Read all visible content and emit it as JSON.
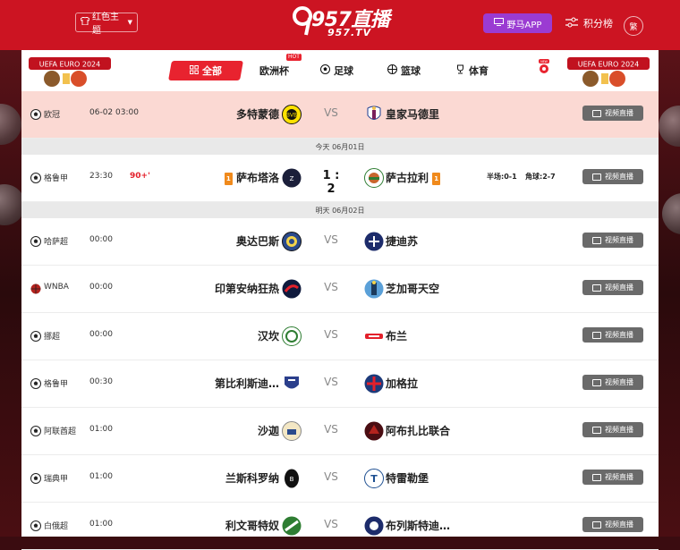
{
  "colors": {
    "brand_red": "#cc1422",
    "accent": "#e8232f",
    "app_purple": "#9b3bd2",
    "live_grey": "#6a6a6a",
    "highlight_row": "#fbd9d3"
  },
  "header": {
    "theme_label": "红色主题",
    "logo_text": "957直播",
    "logo_sub": "957.TV",
    "app_label": "野马APP",
    "rank_label": "积分榜",
    "lang_label": "繁"
  },
  "tabs": [
    {
      "label": "全部",
      "icon": "grid-icon"
    },
    {
      "label": "欧洲杯",
      "badge": "HOT"
    },
    {
      "label": "足球",
      "icon": "soccer-ball-icon"
    },
    {
      "label": "篮球",
      "icon": "basketball-icon"
    },
    {
      "label": "体育",
      "icon": "trophy-icon"
    }
  ],
  "new_badge": "NEW",
  "euro_badge_text": "UEFA EURO 2024",
  "live_label": "视频直播",
  "dividers": {
    "today": "今天 06月01日",
    "tomorrow": "明天 06月02日"
  },
  "matches": [
    {
      "league": "欧冠",
      "time": "06-02 03:00",
      "home": "多特蒙德",
      "away": "皇家马德里",
      "vs": "VS"
    },
    {
      "league": "格鲁甲",
      "time": "23:30",
      "minute": "90+'",
      "home": "萨布塔洛",
      "away": "萨古拉利",
      "score": "1 : 2",
      "home_rank": "1",
      "away_rank": "1",
      "half": "半场:0-1",
      "corner": "角球:2-7"
    },
    {
      "league": "哈萨超",
      "time": "00:00",
      "home": "奥达巴斯",
      "away": "捷迪苏",
      "vs": "VS"
    },
    {
      "league": "WNBA",
      "time": "00:00",
      "home": "印第安纳狂热",
      "away": "芝加哥天空",
      "vs": "VS"
    },
    {
      "league": "挪超",
      "time": "00:00",
      "home": "汉坎",
      "away": "布兰",
      "vs": "VS"
    },
    {
      "league": "格鲁甲",
      "time": "00:30",
      "home": "第比利斯迪…",
      "away": "加格拉",
      "vs": "VS"
    },
    {
      "league": "阿联酋超",
      "time": "01:00",
      "home": "沙迦",
      "away": "阿布扎比联合",
      "vs": "VS"
    },
    {
      "league": "瑞典甲",
      "time": "01:00",
      "home": "兰斯科罗纳",
      "away": "特雷勒堡",
      "vs": "VS"
    },
    {
      "league": "白俄超",
      "time": "01:00",
      "home": "利文哥特奴",
      "away": "布列斯特迪…",
      "vs": "VS"
    }
  ]
}
